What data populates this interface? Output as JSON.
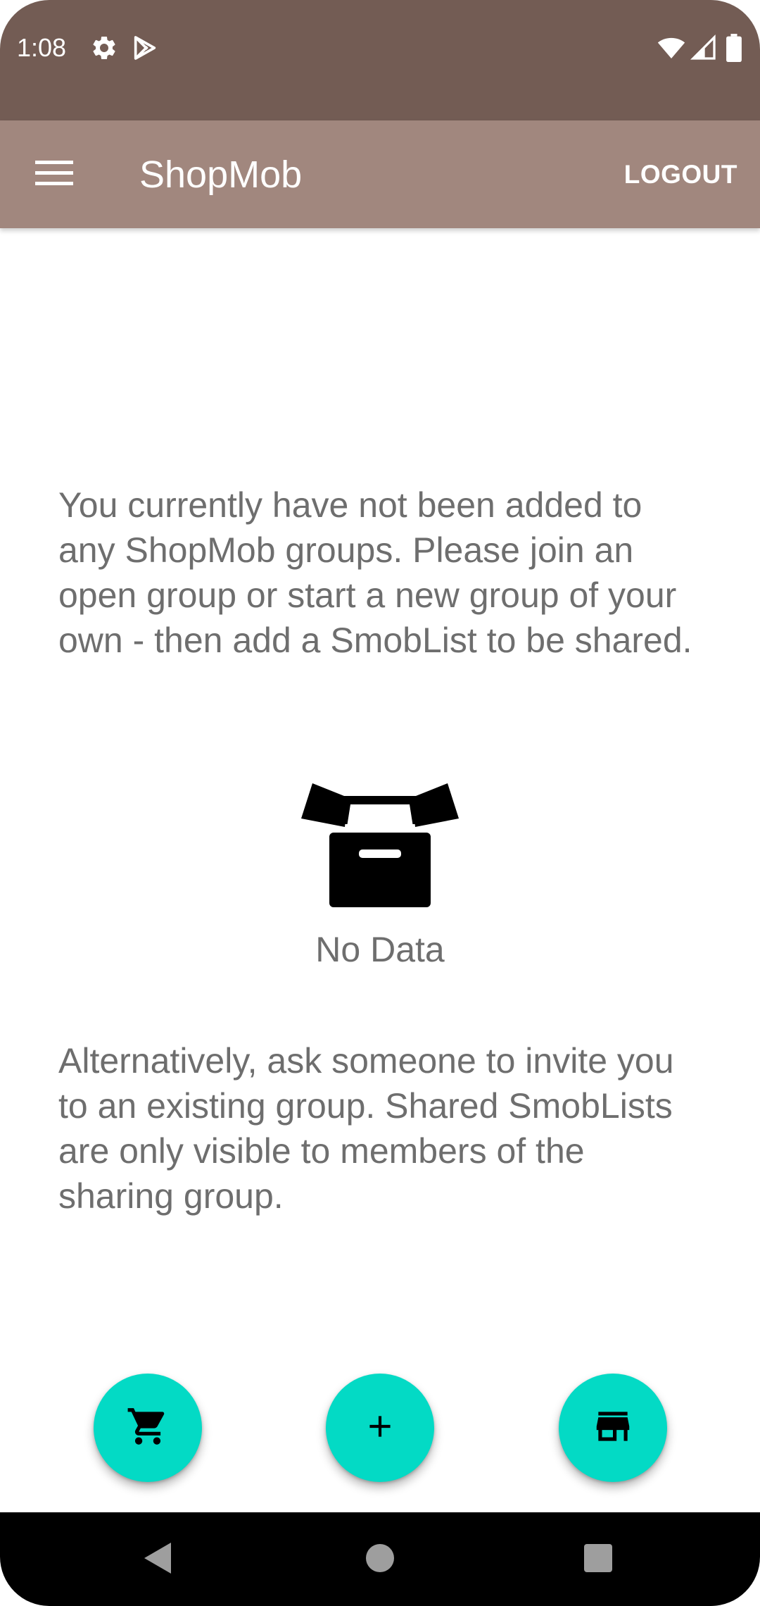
{
  "status_bar": {
    "time": "1:08",
    "icons": [
      "gear-icon",
      "play-store-icon",
      "wifi-icon",
      "signal-icon",
      "battery-icon"
    ],
    "background": "#735C54"
  },
  "app_bar": {
    "title": "ShopMob",
    "logout_label": "LOGOUT",
    "menu_icon": "hamburger-menu-icon",
    "background": "#A1877E"
  },
  "content": {
    "intro_message": "You currently have not been added to any ShopMob groups. Please join an open group or start a new group of your own - then add a SmobList to be shared.",
    "empty_state": {
      "icon": "open-box-icon",
      "label": "No Data"
    },
    "alternative_message": "Alternatively, ask someone to invite you to an existing group. Shared SmobLists are only visible to members of the sharing group."
  },
  "fabs": [
    {
      "icon": "shopping-cart-icon"
    },
    {
      "icon": "add-icon"
    },
    {
      "icon": "store-icon"
    }
  ],
  "fab_color": "#03DAC5",
  "nav_bar": {
    "buttons": [
      "back-icon",
      "home-icon",
      "recents-icon"
    ]
  }
}
